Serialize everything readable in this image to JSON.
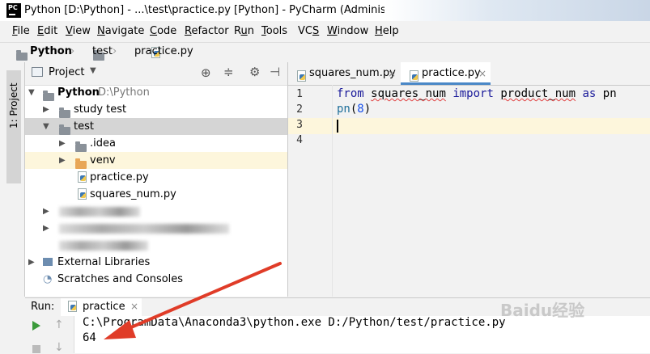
{
  "window": {
    "title": "Python [D:\\Python] - ...\\test\\practice.py [Python] - PyCharm (Administrator)",
    "logo_text": "PC"
  },
  "menu": [
    {
      "label": "File",
      "mnemonic": "F"
    },
    {
      "label": "Edit",
      "mnemonic": "E"
    },
    {
      "label": "View",
      "mnemonic": "V"
    },
    {
      "label": "Navigate",
      "mnemonic": "N"
    },
    {
      "label": "Code",
      "mnemonic": "C"
    },
    {
      "label": "Refactor",
      "mnemonic": "R"
    },
    {
      "label": "Run",
      "mnemonic": "u"
    },
    {
      "label": "Tools",
      "mnemonic": "T"
    },
    {
      "label": "VCS",
      "mnemonic": "S"
    },
    {
      "label": "Window",
      "mnemonic": "W"
    },
    {
      "label": "Help",
      "mnemonic": "H"
    }
  ],
  "breadcrumb": {
    "root": "Python",
    "folder": "test",
    "file": "practice.py"
  },
  "left_stripe": {
    "project_tab": "1: Project"
  },
  "project_panel": {
    "title": "Project",
    "tree": {
      "root_name": "Python",
      "root_path": "D:\\Python",
      "study_test": "study test",
      "test": "test",
      "idea": ".idea",
      "venv": "venv",
      "practice": "practice.py",
      "squares": "squares_num.py",
      "external_libraries": "External Libraries",
      "scratches": "Scratches and Consoles"
    }
  },
  "editor": {
    "tabs": [
      {
        "label": "squares_num.py",
        "active": false
      },
      {
        "label": "practice.py",
        "active": true
      }
    ],
    "line_numbers": [
      "1",
      "2",
      "3",
      "4"
    ],
    "code": {
      "l1_from": "from",
      "l1_module": "squares_num",
      "l1_import": "import",
      "l1_name": "product_num",
      "l1_as": "as",
      "l1_alias": "pn",
      "l2_call": "pn",
      "l2_open": "(",
      "l2_arg": "8",
      "l2_close": ")"
    }
  },
  "run_panel": {
    "label": "Run:",
    "tab": "practice",
    "console_lines": [
      "C:\\ProgramData\\Anaconda3\\python.exe D:/Python/test/practice.py",
      "64"
    ]
  },
  "watermark": "Baidu经验",
  "colors": {
    "keyword": "#1a1a9a",
    "number": "#1750eb",
    "accent": "#4a88c7",
    "arrow": "#e03c28",
    "current_line": "#fdf6dc"
  }
}
